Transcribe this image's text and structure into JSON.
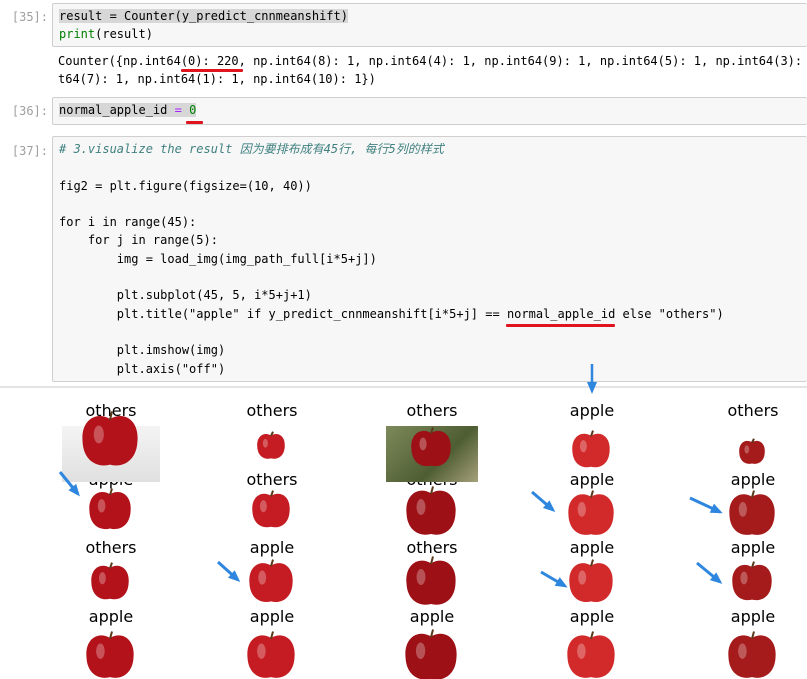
{
  "cells": {
    "c35": {
      "prompt": "[35]:",
      "line1": "result = Counter(y_predict_cnnmeanshift)",
      "line2_fn": "print",
      "line2_rest": "(result)",
      "output_line1": "Counter({np.int64(0): 220, np.int64(8): 1, np.int64(4): 1, np.int64(9): 1, np.int64(5): 1, np.int64(3): 1",
      "output_line2": "t64(7): 1, np.int64(1): 1, np.int64(10): 1})"
    },
    "c36": {
      "prompt": "[36]:",
      "var": "normal_apple_id",
      "op": " = ",
      "value": "0"
    },
    "c37": {
      "prompt": "[37]:",
      "comment": "# 3.visualize the result 因为要排布成有45行, 每行5列的样式",
      "l_fig": "fig2 = plt.figure(figsize=(10, 40))",
      "l_for1": "for i in range(45):",
      "l_for2": "    for j in range(5):",
      "l_img": "        img = load_img(img_path_full[i*5+j])",
      "l_sub": "        plt.subplot(45, 5, i*5+j+1)",
      "l_title_a": "        plt.title(\"apple\" if y_predict_cnnmeanshift[i*5+j] == ",
      "l_title_b": "normal_apple_id",
      "l_title_c": " else \"others\")",
      "l_show": "        plt.imshow(img)",
      "l_axis": "        plt.axis(\"off\")"
    }
  },
  "grid": {
    "rows": [
      [
        "others",
        "others",
        "others",
        "apple",
        "others"
      ],
      [
        "apple",
        "others",
        "others",
        "apple",
        "apple"
      ],
      [
        "others",
        "apple",
        "others",
        "apple",
        "apple"
      ],
      [
        "apple",
        "apple",
        "apple",
        "apple",
        "apple"
      ]
    ]
  },
  "colors": {
    "annotation_red": "#e0141e",
    "arrow_blue": "#2e86de",
    "apple_red": "#c0141c"
  }
}
